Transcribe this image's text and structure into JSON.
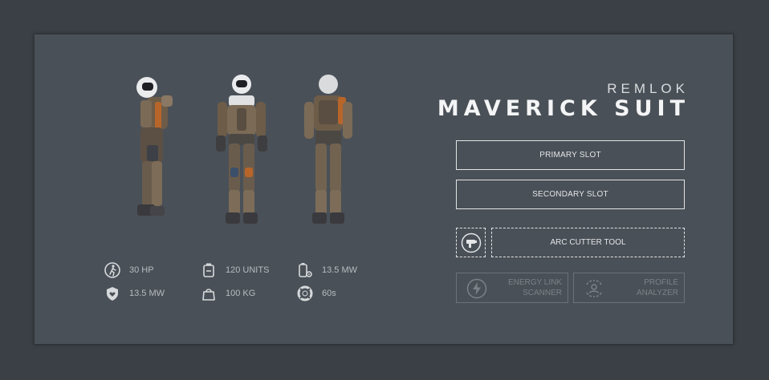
{
  "brand": {
    "maker": "REMLOK",
    "name": "MAVERICK SUIT"
  },
  "slots": {
    "primary": "PRIMARY SLOT",
    "secondary": "SECONDARY SLOT",
    "tool": "ARC CUTTER TOOL"
  },
  "utilities": [
    {
      "line1": "ENERGY LINK",
      "line2": "SCANNER",
      "icon": "lightning-icon"
    },
    {
      "line1": "PROFILE",
      "line2": "ANALYZER",
      "icon": "profile-scan-icon"
    }
  ],
  "stats": [
    {
      "icon": "walking-person-icon",
      "value": "30 HP"
    },
    {
      "icon": "battery-case-icon",
      "value": "120 UNITS"
    },
    {
      "icon": "battery-gear-icon",
      "value": "13.5 MW"
    },
    {
      "icon": "shield-heart-icon",
      "value": "13.5 MW"
    },
    {
      "icon": "weight-bag-icon",
      "value": "100 KG"
    },
    {
      "icon": "lifebuoy-icon",
      "value": "60s"
    }
  ],
  "colors": {
    "background": "#3b4047",
    "panel": "#4a5057",
    "accent_orange": "#b8652a",
    "suit": "#7b6a55"
  }
}
